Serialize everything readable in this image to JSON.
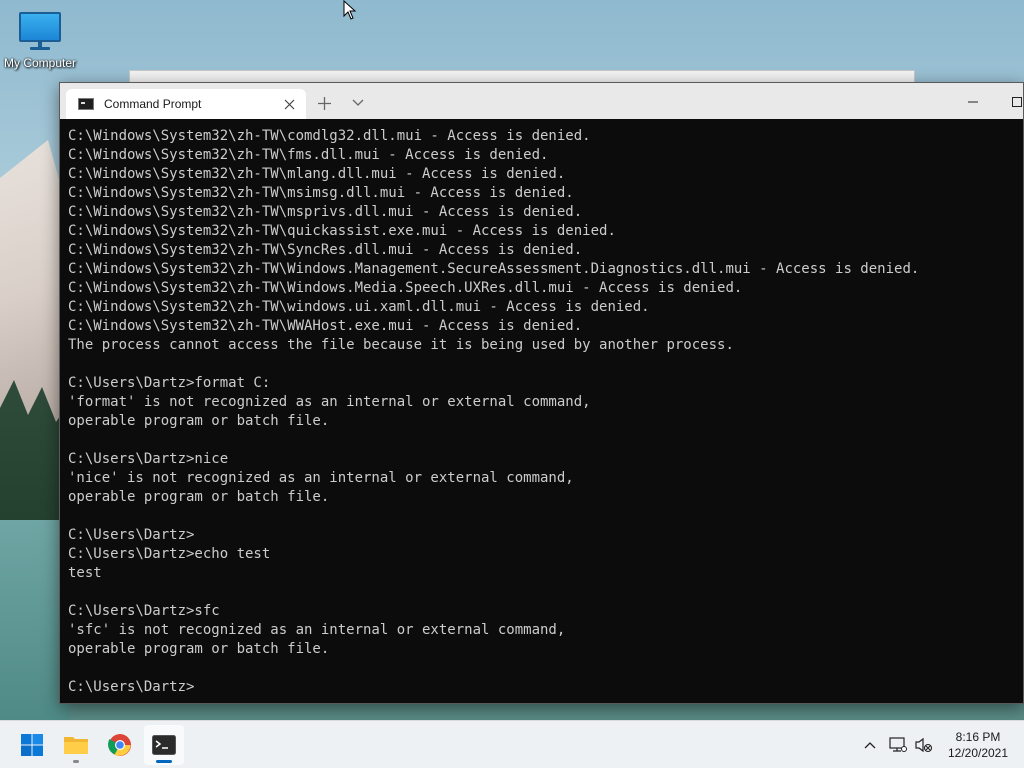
{
  "desktop": {
    "icon_label": "My Computer"
  },
  "terminal": {
    "tab_title": "Command Prompt",
    "lines": [
      "C:\\Windows\\System32\\zh-TW\\comdlg32.dll.mui - Access is denied.",
      "C:\\Windows\\System32\\zh-TW\\fms.dll.mui - Access is denied.",
      "C:\\Windows\\System32\\zh-TW\\mlang.dll.mui - Access is denied.",
      "C:\\Windows\\System32\\zh-TW\\msimsg.dll.mui - Access is denied.",
      "C:\\Windows\\System32\\zh-TW\\msprivs.dll.mui - Access is denied.",
      "C:\\Windows\\System32\\zh-TW\\quickassist.exe.mui - Access is denied.",
      "C:\\Windows\\System32\\zh-TW\\SyncRes.dll.mui - Access is denied.",
      "C:\\Windows\\System32\\zh-TW\\Windows.Management.SecureAssessment.Diagnostics.dll.mui - Access is denied.",
      "C:\\Windows\\System32\\zh-TW\\Windows.Media.Speech.UXRes.dll.mui - Access is denied.",
      "C:\\Windows\\System32\\zh-TW\\windows.ui.xaml.dll.mui - Access is denied.",
      "C:\\Windows\\System32\\zh-TW\\WWAHost.exe.mui - Access is denied.",
      "The process cannot access the file because it is being used by another process.",
      "",
      "C:\\Users\\Dartz>format C:",
      "'format' is not recognized as an internal or external command,",
      "operable program or batch file.",
      "",
      "C:\\Users\\Dartz>nice",
      "'nice' is not recognized as an internal or external command,",
      "operable program or batch file.",
      "",
      "C:\\Users\\Dartz>",
      "C:\\Users\\Dartz>echo test",
      "test",
      "",
      "C:\\Users\\Dartz>sfc",
      "'sfc' is not recognized as an internal or external command,",
      "operable program or batch file.",
      "",
      "C:\\Users\\Dartz>"
    ]
  },
  "taskbar": {
    "apps": [
      {
        "name": "start-icon",
        "active": false
      },
      {
        "name": "file-explorer-icon",
        "active": false
      },
      {
        "name": "chrome-icon",
        "active": false
      },
      {
        "name": "terminal-icon",
        "active": true
      }
    ],
    "tray_icons": [
      "chevron-up-icon",
      "network-icon",
      "volume-muted-icon"
    ],
    "clock_time": "8:16 PM",
    "clock_date": "12/20/2021"
  },
  "colors": {
    "console_bg": "#0c0c0c",
    "console_fg": "#cccccc",
    "accent": "#0067c0"
  }
}
